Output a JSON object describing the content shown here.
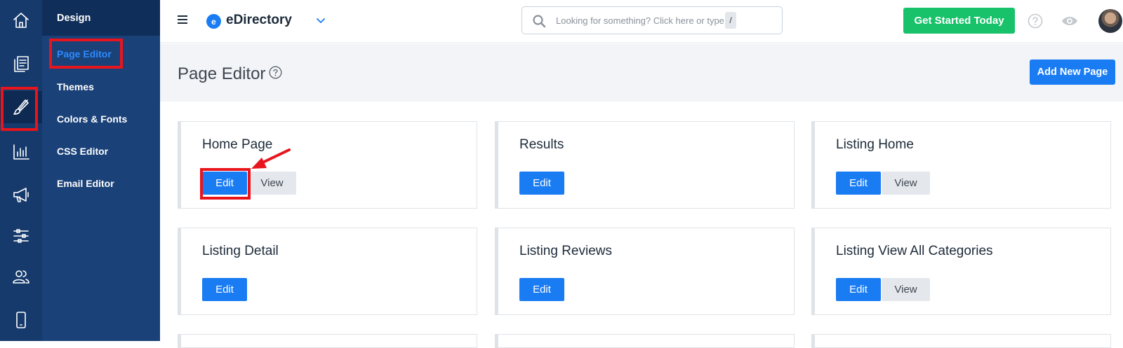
{
  "brand": {
    "name": "eDirectory",
    "logo_letter": "e"
  },
  "rail": {
    "items": [
      {
        "name": "home-icon",
        "active": false
      },
      {
        "name": "content-icon",
        "active": false
      },
      {
        "name": "design-brush-icon",
        "active": true
      },
      {
        "name": "reports-chart-icon",
        "active": false
      },
      {
        "name": "promote-megaphone-icon",
        "active": false
      },
      {
        "name": "settings-sliders-icon",
        "active": false
      },
      {
        "name": "users-icon",
        "active": false
      },
      {
        "name": "mobile-icon",
        "active": false
      }
    ]
  },
  "submenu": {
    "title": "Design",
    "items": [
      {
        "label": "Page Editor",
        "active": true
      },
      {
        "label": "Themes",
        "active": false
      },
      {
        "label": "Colors & Fonts",
        "active": false
      },
      {
        "label": "CSS Editor",
        "active": false
      },
      {
        "label": "Email Editor",
        "active": false
      }
    ]
  },
  "topbar": {
    "search_placeholder": "Looking for something? Click here or type",
    "search_shortcut": "/",
    "cta_label": "Get Started Today"
  },
  "header": {
    "title": "Page Editor",
    "add_button": "Add New Page"
  },
  "pages": [
    {
      "title": "Home Page",
      "edit": "Edit",
      "view": "View"
    },
    {
      "title": "Results",
      "edit": "Edit"
    },
    {
      "title": "Listing Home",
      "edit": "Edit",
      "view": "View"
    },
    {
      "title": "Listing Detail",
      "edit": "Edit"
    },
    {
      "title": "Listing Reviews",
      "edit": "Edit"
    },
    {
      "title": "Listing View All Categories",
      "edit": "Edit",
      "view": "View"
    }
  ],
  "colors": {
    "rail": "#163a6c",
    "submenu": "#1a4178",
    "primary": "#1a7cf3",
    "cta": "#18c26a",
    "highlight": "#e8151c"
  }
}
